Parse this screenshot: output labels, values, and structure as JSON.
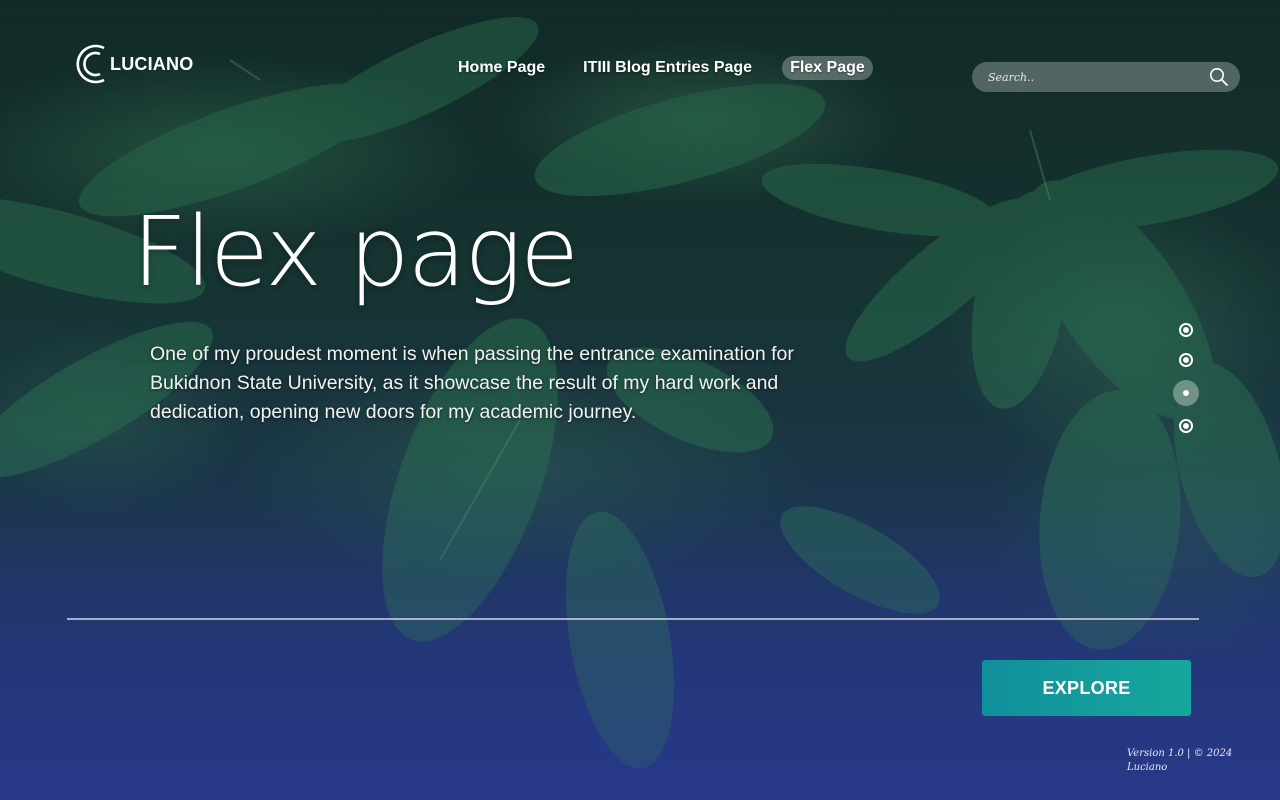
{
  "brand": {
    "name": "LUCIANO"
  },
  "nav": {
    "items": [
      {
        "label": "Home Page",
        "active": false
      },
      {
        "label": "ITIII Blog Entries Page",
        "active": false
      },
      {
        "label": "Flex Page",
        "active": true
      }
    ]
  },
  "search": {
    "placeholder": "Search..",
    "icon": "search-icon"
  },
  "hero": {
    "title": "Flex page",
    "text": "One of my proudest moment is when passing the entrance examination for Bukidnon State University, as it showcase the result of my hard work and dedication, opening new doors for my academic journey."
  },
  "pager": {
    "count": 4,
    "active_index": 2
  },
  "cta": {
    "label": "EXPLORE"
  },
  "footer": {
    "line1": "Version 1.0 | © 2024",
    "line2": "Luciano"
  },
  "colors": {
    "accent": "#16a89c",
    "bg_bottom": "#283b86",
    "foliage": "#1f5a44"
  }
}
